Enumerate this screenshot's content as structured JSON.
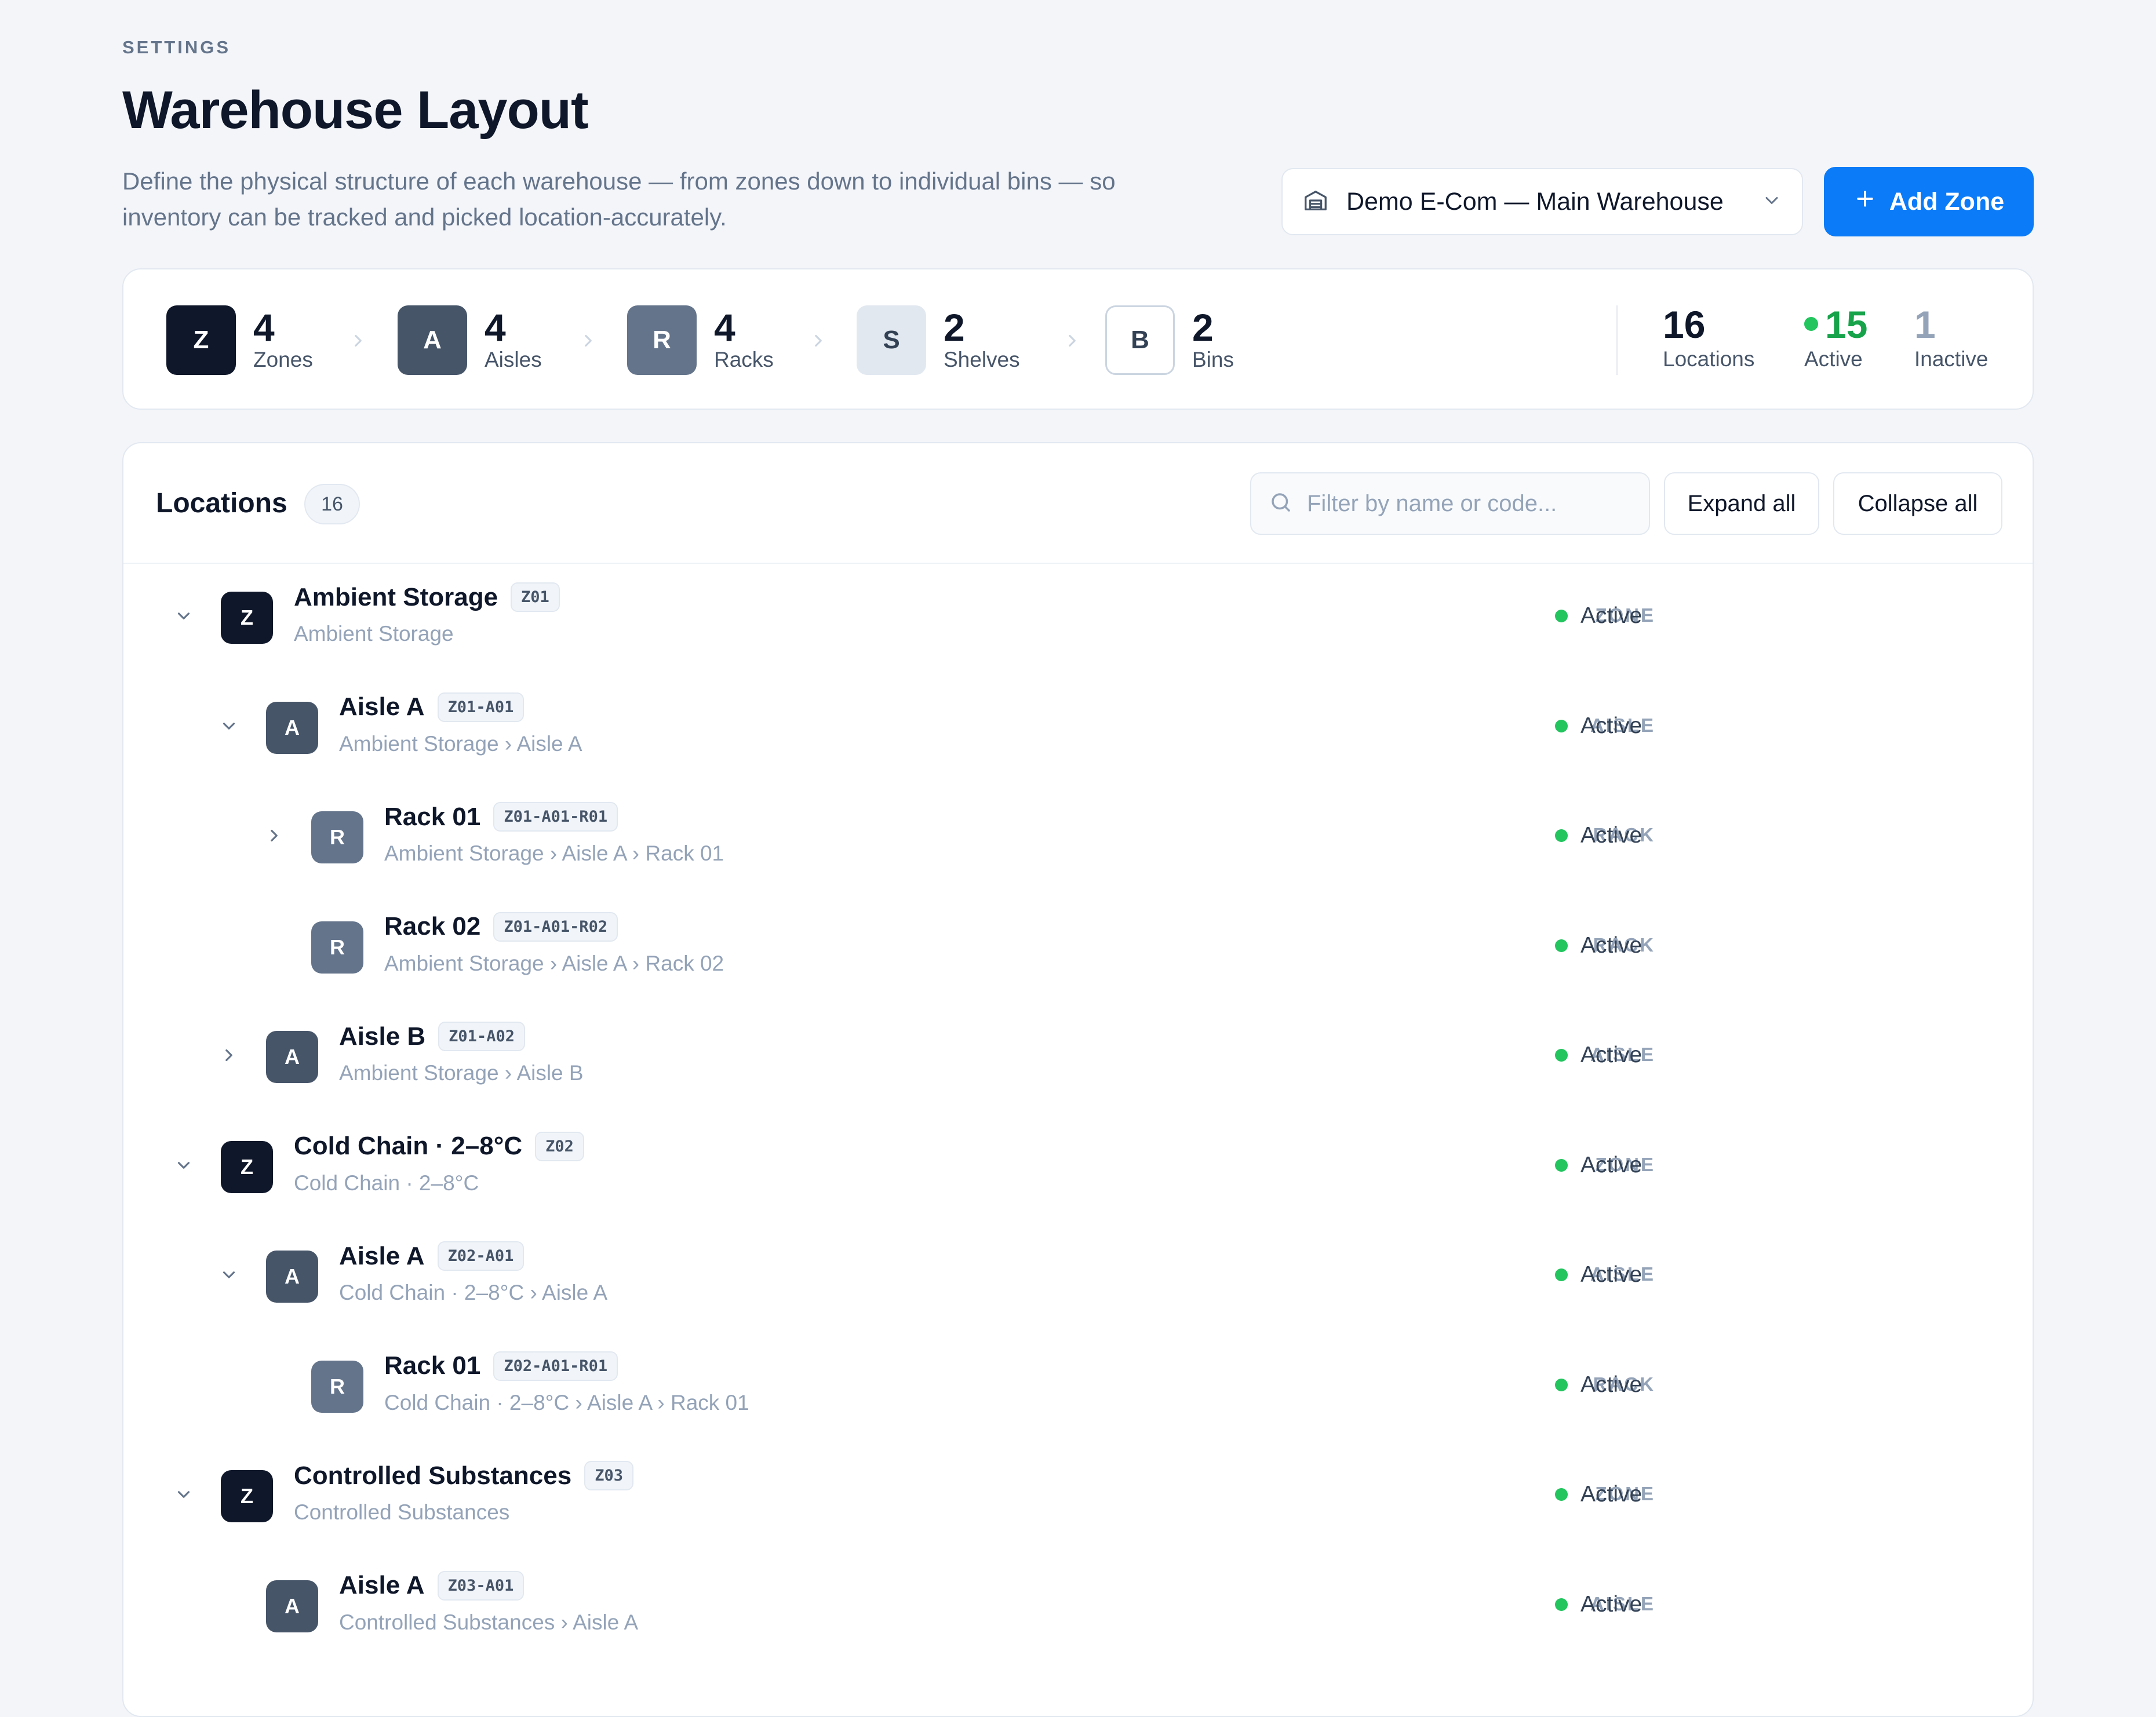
{
  "header": {
    "eyebrow": "SETTINGS",
    "title": "Warehouse Layout",
    "description": "Define the physical structure of each warehouse — from zones down to individual bins — so inventory can be tracked and picked location-accurately.",
    "warehouse_select": "Demo E-Com — Main Warehouse",
    "add_zone_label": "Add Zone"
  },
  "stats": {
    "levels": [
      {
        "letter": "Z",
        "count": "4",
        "label": "Zones"
      },
      {
        "letter": "A",
        "count": "4",
        "label": "Aisles"
      },
      {
        "letter": "R",
        "count": "4",
        "label": "Racks"
      },
      {
        "letter": "S",
        "count": "2",
        "label": "Shelves"
      },
      {
        "letter": "B",
        "count": "2",
        "label": "Bins"
      }
    ],
    "summary": {
      "locations_count": "16",
      "locations_label": "Locations",
      "active_count": "15",
      "active_label": "Active",
      "inactive_count": "1",
      "inactive_label": "Inactive"
    }
  },
  "locations": {
    "title": "Locations",
    "count": "16",
    "filter_placeholder": "Filter by name or code...",
    "expand_all": "Expand all",
    "collapse_all": "Collapse all",
    "rows": [
      {
        "level": 0,
        "toggle": "down",
        "letter": "Z",
        "name": "Ambient Storage",
        "code": "Z01",
        "path": "Ambient Storage",
        "type": "ZONE",
        "status": "Active"
      },
      {
        "level": 1,
        "toggle": "down",
        "letter": "A",
        "name": "Aisle A",
        "code": "Z01-A01",
        "path": "Ambient Storage › Aisle A",
        "type": "AISLE",
        "status": "Active"
      },
      {
        "level": 2,
        "toggle": "right",
        "letter": "R",
        "name": "Rack 01",
        "code": "Z01-A01-R01",
        "path": "Ambient Storage › Aisle A › Rack 01",
        "type": "RACK",
        "status": "Active"
      },
      {
        "level": 2,
        "toggle": "none",
        "letter": "R",
        "name": "Rack 02",
        "code": "Z01-A01-R02",
        "path": "Ambient Storage › Aisle A › Rack 02",
        "type": "RACK",
        "status": "Active"
      },
      {
        "level": 1,
        "toggle": "right",
        "letter": "A",
        "name": "Aisle B",
        "code": "Z01-A02",
        "path": "Ambient Storage › Aisle B",
        "type": "AISLE",
        "status": "Active"
      },
      {
        "level": 0,
        "toggle": "down",
        "letter": "Z",
        "name": "Cold Chain · 2–8°C",
        "code": "Z02",
        "path": "Cold Chain · 2–8°C",
        "type": "ZONE",
        "status": "Active"
      },
      {
        "level": 1,
        "toggle": "down",
        "letter": "A",
        "name": "Aisle A",
        "code": "Z02-A01",
        "path": "Cold Chain · 2–8°C › Aisle A",
        "type": "AISLE",
        "status": "Active"
      },
      {
        "level": 2,
        "toggle": "none",
        "letter": "R",
        "name": "Rack 01",
        "code": "Z02-A01-R01",
        "path": "Cold Chain · 2–8°C › Aisle A › Rack 01",
        "type": "RACK",
        "status": "Active"
      },
      {
        "level": 0,
        "toggle": "down",
        "letter": "Z",
        "name": "Controlled Substances",
        "code": "Z03",
        "path": "Controlled Substances",
        "type": "ZONE",
        "status": "Active"
      },
      {
        "level": 1,
        "toggle": "none",
        "letter": "A",
        "name": "Aisle A",
        "code": "Z03-A01",
        "path": "Controlled Substances › Aisle A",
        "type": "AISLE",
        "status": "Active"
      }
    ]
  },
  "colors": {
    "accent": "#0b7bf7",
    "active_green": "#22c55e",
    "zone_badge": "#0f172a",
    "aisle_badge": "#475569",
    "rack_badge": "#64748b"
  },
  "icons": {
    "warehouse": "warehouse-icon",
    "chevron_down": "chevron-down-icon",
    "chevron_right": "chevron-right-icon",
    "plus": "plus-icon",
    "search": "search-icon"
  }
}
